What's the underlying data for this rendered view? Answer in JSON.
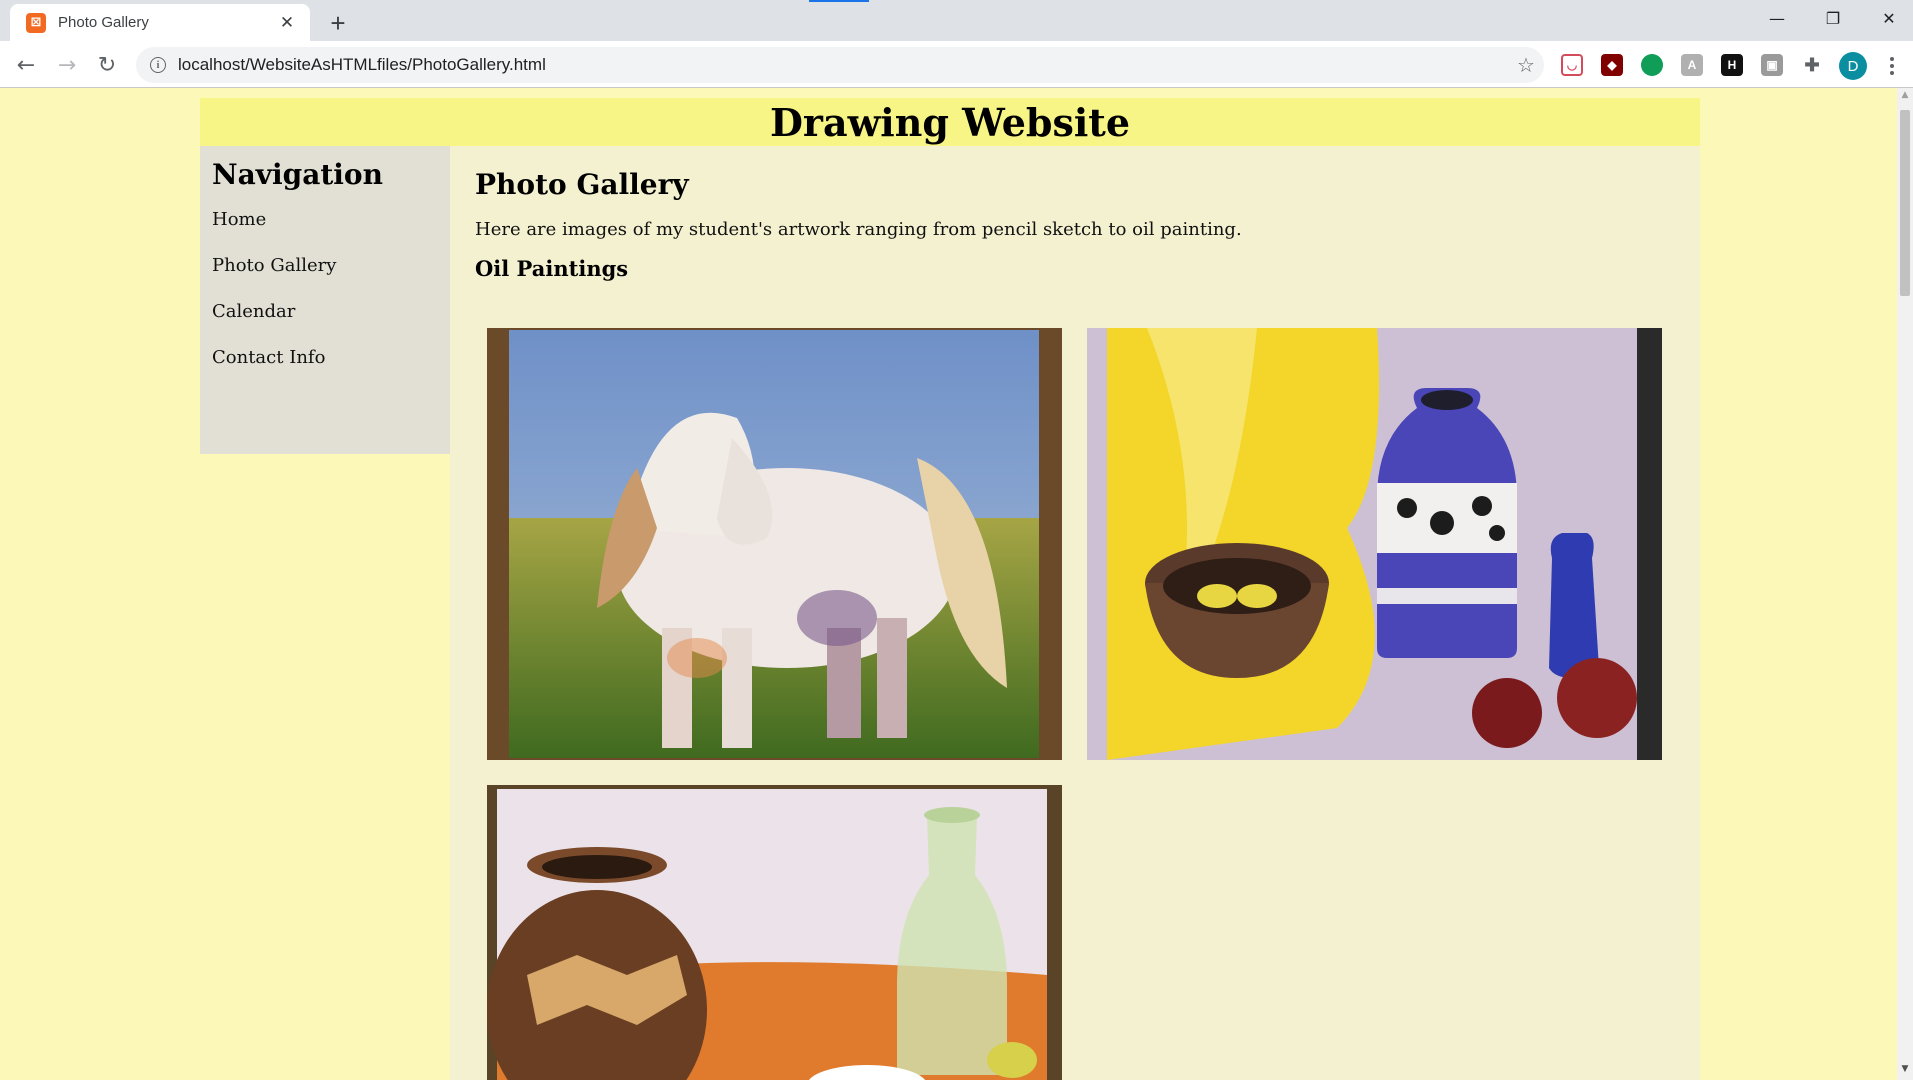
{
  "browser": {
    "tab_title": "Photo Gallery",
    "url": "localhost/WebsiteAsHTMLfiles/PhotoGallery.html",
    "profile_initial": "D",
    "favicon_color": "#f26a22",
    "extensions": [
      "pocket-icon",
      "ublock-icon",
      "green-dot-icon",
      "translate-icon",
      "h-icon",
      "image-icon",
      "puzzle-icon"
    ]
  },
  "site": {
    "title": "Drawing Website",
    "nav": {
      "heading": "Navigation",
      "links": [
        "Home",
        "Photo Gallery",
        "Calendar",
        "Contact Info"
      ]
    },
    "main": {
      "heading": "Photo Gallery",
      "intro": "Here are images of my student's artwork ranging from pencil sketch to oil painting.",
      "section": "Oil Paintings",
      "paintings": [
        {
          "subject": "white horse in a field"
        },
        {
          "subject": "still life with bowl, blue vase and pomegranates"
        },
        {
          "subject": "still life with clay pot and glass carafe"
        }
      ]
    }
  },
  "colors": {
    "page_bg": "#fcf9b8",
    "header_bg": "#f7f586",
    "nav_bg": "#e2e0d4",
    "main_bg": "#f4f1d0"
  }
}
